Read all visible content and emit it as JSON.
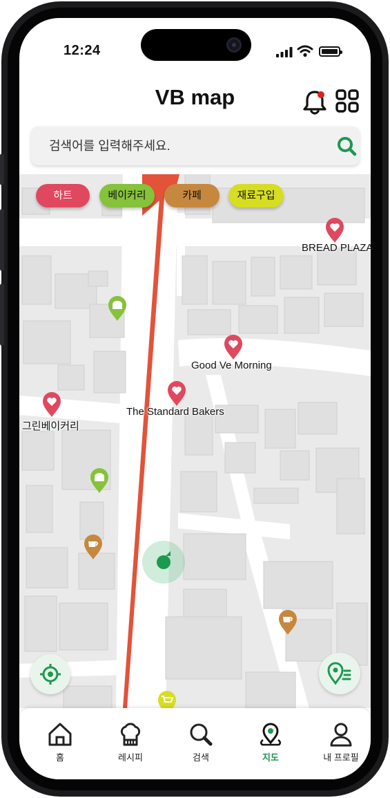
{
  "status_bar": {
    "time": "12:24"
  },
  "header": {
    "title": "VB map",
    "notification_dot_color": "#e02020"
  },
  "search": {
    "placeholder": "검색어를 입력해주세요."
  },
  "category_chips": [
    {
      "label": "하트",
      "color": "#e04860"
    },
    {
      "label": "베이커리",
      "color": "#86c23a"
    },
    {
      "label": "카페",
      "color": "#c6883e"
    },
    {
      "label": "재료구입",
      "color": "#d7de22"
    }
  ],
  "map": {
    "places": [
      {
        "name": "BREAD PLAZA",
        "type": "heart"
      },
      {
        "name": "Good Ve Morning",
        "type": "heart"
      },
      {
        "name": "The Standard Bakers",
        "type": "heart"
      },
      {
        "name": "그린베이커리",
        "type": "heart"
      }
    ],
    "unlabeled_pins": [
      "bakery",
      "bakery",
      "cafe",
      "cafe",
      "ingredients"
    ]
  },
  "bottom_nav": {
    "items": [
      {
        "label": "홈",
        "icon": "home-icon"
      },
      {
        "label": "레시피",
        "icon": "chef-hat-icon"
      },
      {
        "label": "검색",
        "icon": "search-icon"
      },
      {
        "label": "지도",
        "icon": "map-pin-icon",
        "active": true
      },
      {
        "label": "내 프로필",
        "icon": "user-icon"
      }
    ],
    "active_color": "#1c8f4a"
  },
  "accent_color": "#1c9a50"
}
